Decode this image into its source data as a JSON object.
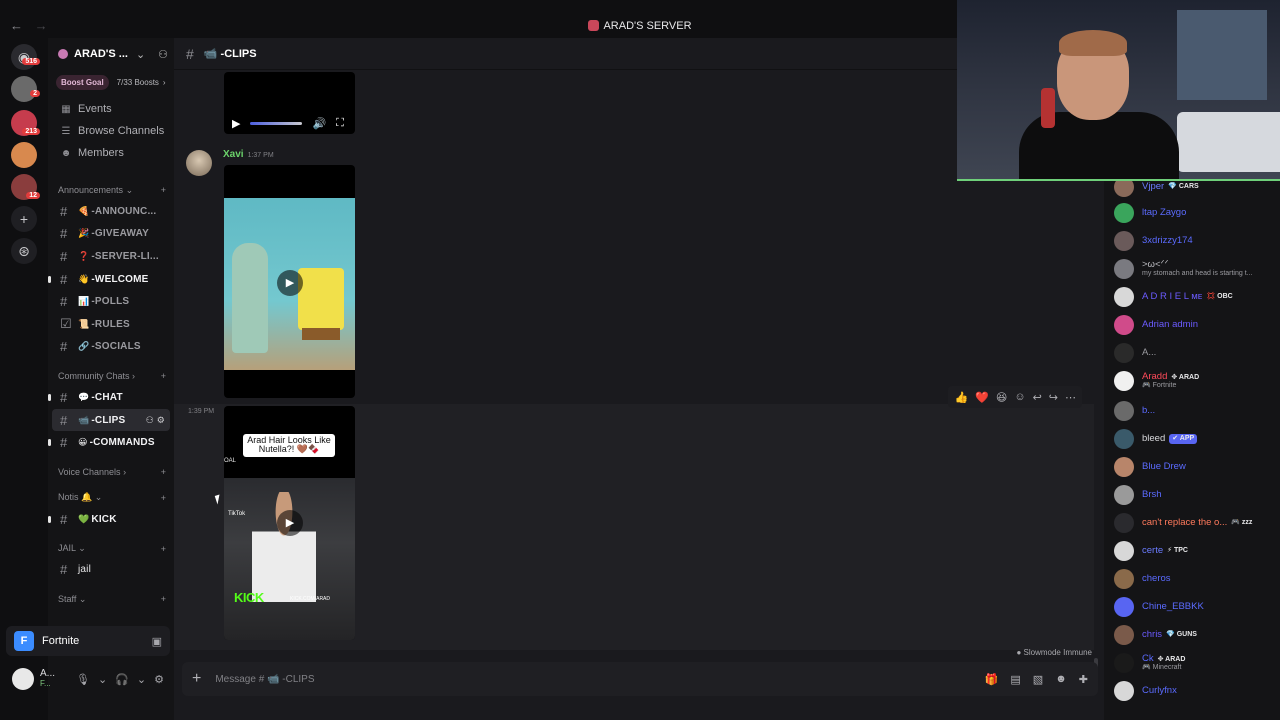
{
  "window": {
    "title": "ARAD'S SERVER",
    "back": "←",
    "forward": "→"
  },
  "rail": {
    "badges": [
      "516",
      "2",
      "213",
      "",
      "12"
    ]
  },
  "server": {
    "name": "ARAD'S ...",
    "boost_label": "Boost Goal",
    "boost_count": "7/33 Boosts",
    "menu": [
      {
        "icon": "calendar-icon",
        "label": "Events"
      },
      {
        "icon": "browse-icon",
        "label": "Browse Channels"
      },
      {
        "icon": "members-icon",
        "label": "Members"
      }
    ],
    "categories": {
      "announcements": "Announcements",
      "community": "Community Chats",
      "voice": "Voice Channels",
      "notis": "Notis 🔔",
      "jail": "JAIL",
      "staff": "Staff"
    },
    "channels_a": [
      {
        "emoji": "🍕",
        "label": "-ANNOUNC..."
      },
      {
        "emoji": "🎉",
        "label": "-GIVEAWAY"
      },
      {
        "emoji": "❓",
        "label": "-SERVER-LI..."
      },
      {
        "emoji": "👋",
        "label": "-WELCOME"
      },
      {
        "emoji": "📊",
        "label": "-POLLS"
      },
      {
        "emoji": "📜",
        "label": "-RULES"
      },
      {
        "emoji": "🔗",
        "label": "-SOCIALS"
      }
    ],
    "channels_b": [
      {
        "emoji": "💬",
        "label": "-CHAT"
      },
      {
        "emoji": "📹",
        "label": "-CLIPS"
      },
      {
        "emoji": "😀",
        "label": "-COMMANDS"
      }
    ],
    "kick_channel": {
      "emoji": "💚",
      "label": "KICK"
    },
    "jail_channel": "jail"
  },
  "game_activity": {
    "name": "Fortnite"
  },
  "user": {
    "name": "A...",
    "status": "F..."
  },
  "channel": {
    "name": "📹 -CLIPS",
    "composer_placeholder": "Message # 📹 -CLIPS",
    "slowmode": "Slowmode Immune"
  },
  "messages": [
    {
      "author": "Xavi",
      "time": "1:37 PM"
    },
    {
      "author": "",
      "time": "1:39 PM",
      "caption": "Arad Hair Looks Like Nutella?! 🤎🍫",
      "overlay_tiktok": "TikTok",
      "overlay_kick": "KICK",
      "overlay_oal": "OAL",
      "overlay_url": "KICK.COM/ARAD"
    }
  ],
  "reaction_bar": [
    "👍",
    "❤️",
    "😆"
  ],
  "members": [
    {
      "name": "Vjper",
      "tag": "💎 CARS",
      "color": "#6b7cff"
    },
    {
      "name": "ltap Zaygo",
      "tag": "",
      "color": "#5b6bff"
    },
    {
      "name": "3xdrizzy174",
      "tag": "",
      "color": "#5b6bff"
    },
    {
      "name": ">ω<ᐟᐟ",
      "sub": "my stomach and head is starting t...",
      "tag": "",
      "color": "#bdbdc2"
    },
    {
      "name": "A D R I E L ᴍᴇ",
      "tag": "💢 OBC",
      "color": "#6b5bff"
    },
    {
      "name": "Adrian admin",
      "tag": "",
      "color": "#6b5bff"
    },
    {
      "name": "A...",
      "tag": "",
      "color": "#9b9ba0"
    },
    {
      "name": "Aradd",
      "tag": "✥ ARAD",
      "sub": "🎮 Fortnite",
      "color": "#ff4a5a"
    },
    {
      "name": "b...",
      "tag": "",
      "color": "#5b6bff"
    },
    {
      "name": "bleed",
      "tag": "✔ APP",
      "color": "#d8d8dc"
    },
    {
      "name": "Blue Drew",
      "tag": "",
      "color": "#5b6bff"
    },
    {
      "name": "Brsh",
      "tag": "",
      "color": "#5b6bff"
    },
    {
      "name": "can't replace the o...",
      "tag": "🎮 zzz",
      "color": "#ff7a5c"
    },
    {
      "name": "certe",
      "tag": "⚡ TPC",
      "color": "#6b7cff"
    },
    {
      "name": "cheros",
      "tag": "",
      "color": "#5b6bff"
    },
    {
      "name": "Chine_EBBKK",
      "tag": "",
      "color": "#5b6bff"
    },
    {
      "name": "chris",
      "tag": "💎 GUNS",
      "color": "#6b5bff"
    },
    {
      "name": "Ck",
      "tag": "✥ ARAD",
      "sub": "🎮 Minecraft",
      "color": "#5b6bff"
    },
    {
      "name": "Curlyfnx",
      "tag": "",
      "color": "#5b6bff"
    }
  ]
}
